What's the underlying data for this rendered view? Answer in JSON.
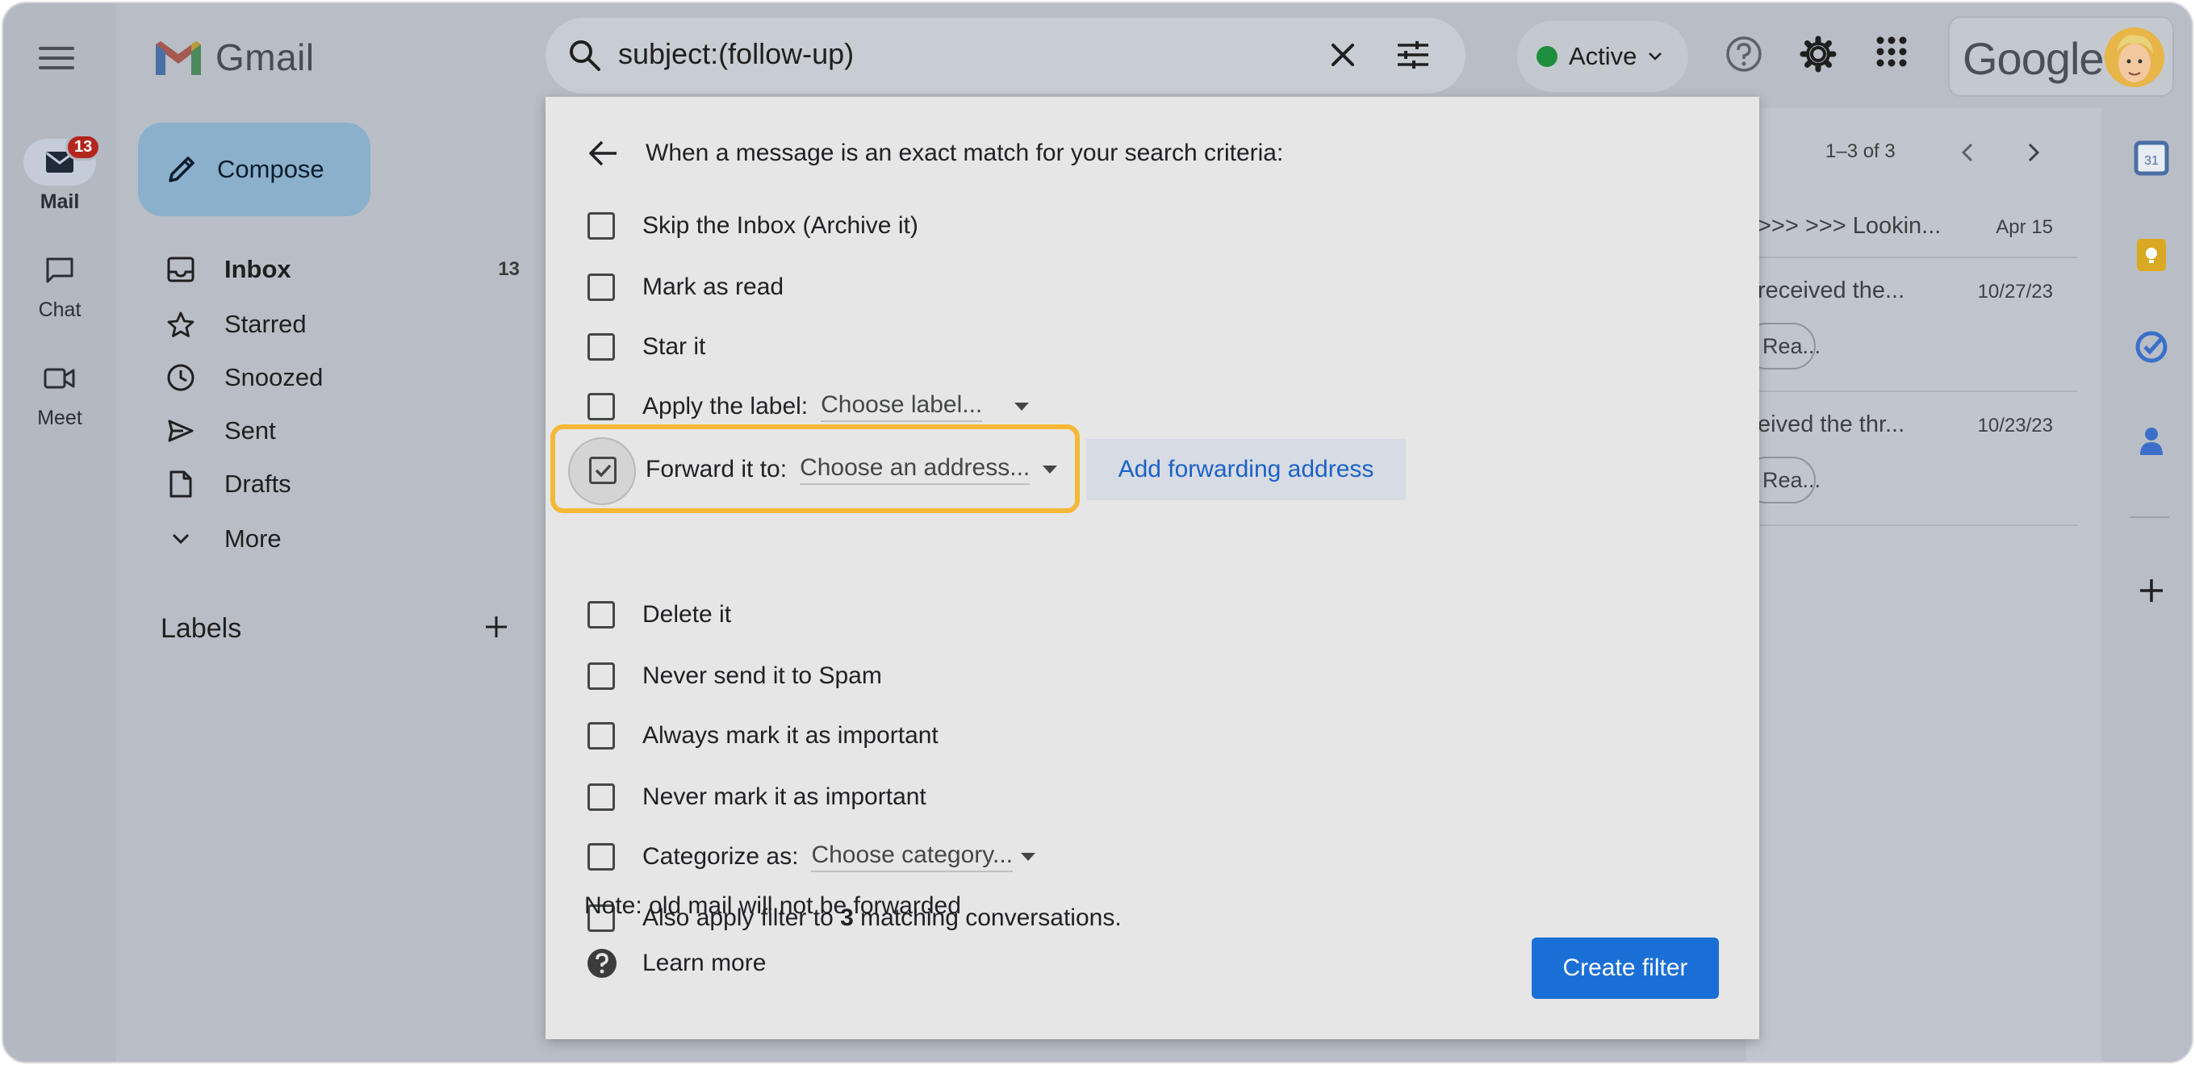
{
  "app": {
    "name": "Gmail",
    "account_brand": "Google"
  },
  "rail": {
    "items": [
      {
        "label": "Mail",
        "badge": "13",
        "icon": "mail-icon"
      },
      {
        "label": "Chat",
        "icon": "chat-icon"
      },
      {
        "label": "Meet",
        "icon": "video-icon"
      }
    ]
  },
  "search": {
    "query": "subject:(follow-up)"
  },
  "status": {
    "label": "Active",
    "color": "#1e8e3e"
  },
  "sidebar": {
    "compose_label": "Compose",
    "items": [
      {
        "label": "Inbox",
        "count": "13",
        "icon": "inbox-icon"
      },
      {
        "label": "Starred",
        "icon": "star-icon"
      },
      {
        "label": "Snoozed",
        "icon": "clock-icon"
      },
      {
        "label": "Sent",
        "icon": "send-icon"
      },
      {
        "label": "Drafts",
        "icon": "draft-icon"
      },
      {
        "label": "More",
        "icon": "chevron-down-icon"
      }
    ],
    "labels_heading": "Labels"
  },
  "list": {
    "pager": "1–3 of 3",
    "rows": [
      {
        "snippet": ">>> >>> Lookin...",
        "date": "Apr 15"
      },
      {
        "snippet": "received the...",
        "date": "10/27/23",
        "chip": "Rea..."
      },
      {
        "snippet": "eived the thr...",
        "date": "10/23/23",
        "chip": "Rea..."
      }
    ]
  },
  "dialog": {
    "heading": "When a message is an exact match for your search criteria:",
    "options": {
      "skip_inbox": "Skip the Inbox (Archive it)",
      "mark_read": "Mark as read",
      "star": "Star it",
      "apply_label": "Apply the label:",
      "apply_label_select": "Choose label...",
      "forward": "Forward it to:",
      "forward_select": "Choose an address...",
      "add_forwarding": "Add forwarding address",
      "delete": "Delete it",
      "never_spam": "Never send it to Spam",
      "always_important": "Always mark it as important",
      "never_important": "Never mark it as important",
      "categorize": "Categorize as:",
      "categorize_select": "Choose category...",
      "also_apply_prefix": "Also apply filter to",
      "also_apply_count": "3",
      "also_apply_suffix": "matching conversations."
    },
    "forward_checked": true,
    "note": "Note: old mail will not be forwarded",
    "learn_more": "Learn more",
    "create_filter": "Create filter"
  },
  "colors": {
    "highlight": "#f4b836",
    "primary_button": "#1a6fd6",
    "link": "#1a62c9"
  }
}
